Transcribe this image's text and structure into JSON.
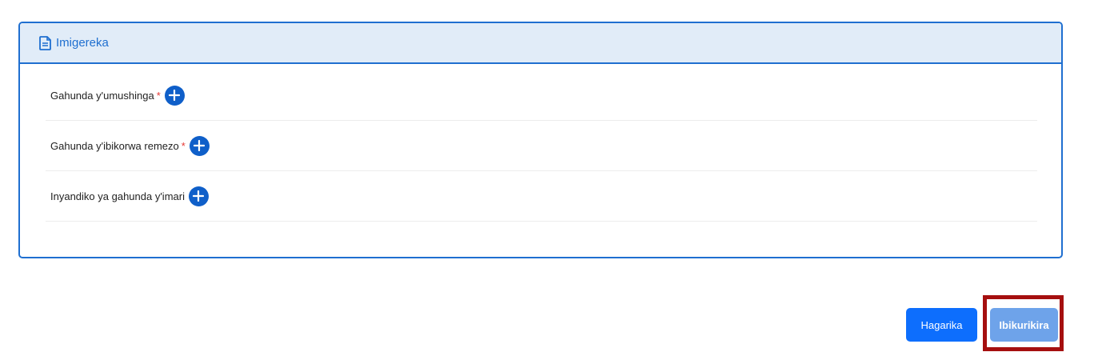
{
  "section": {
    "title": "Imigereka",
    "icon": "document-icon"
  },
  "attachments": [
    {
      "label": "Gahunda y'umushinga",
      "required_mark": "*"
    },
    {
      "label": "Gahunda y'ibikorwa remezo",
      "required_mark": "*"
    },
    {
      "label": "Inyandiko ya gahunda y'imari",
      "required_mark": ""
    }
  ],
  "actions": {
    "cancel_label": "Hagarika",
    "next_label": "Ibikurikira"
  },
  "colors": {
    "primary": "#0d6efd",
    "header_bg": "#e1ecf8",
    "border": "#1f6fd0",
    "required": "#e53935",
    "highlight_frame": "#a50f0f",
    "next_button": "#6ea3ea"
  }
}
